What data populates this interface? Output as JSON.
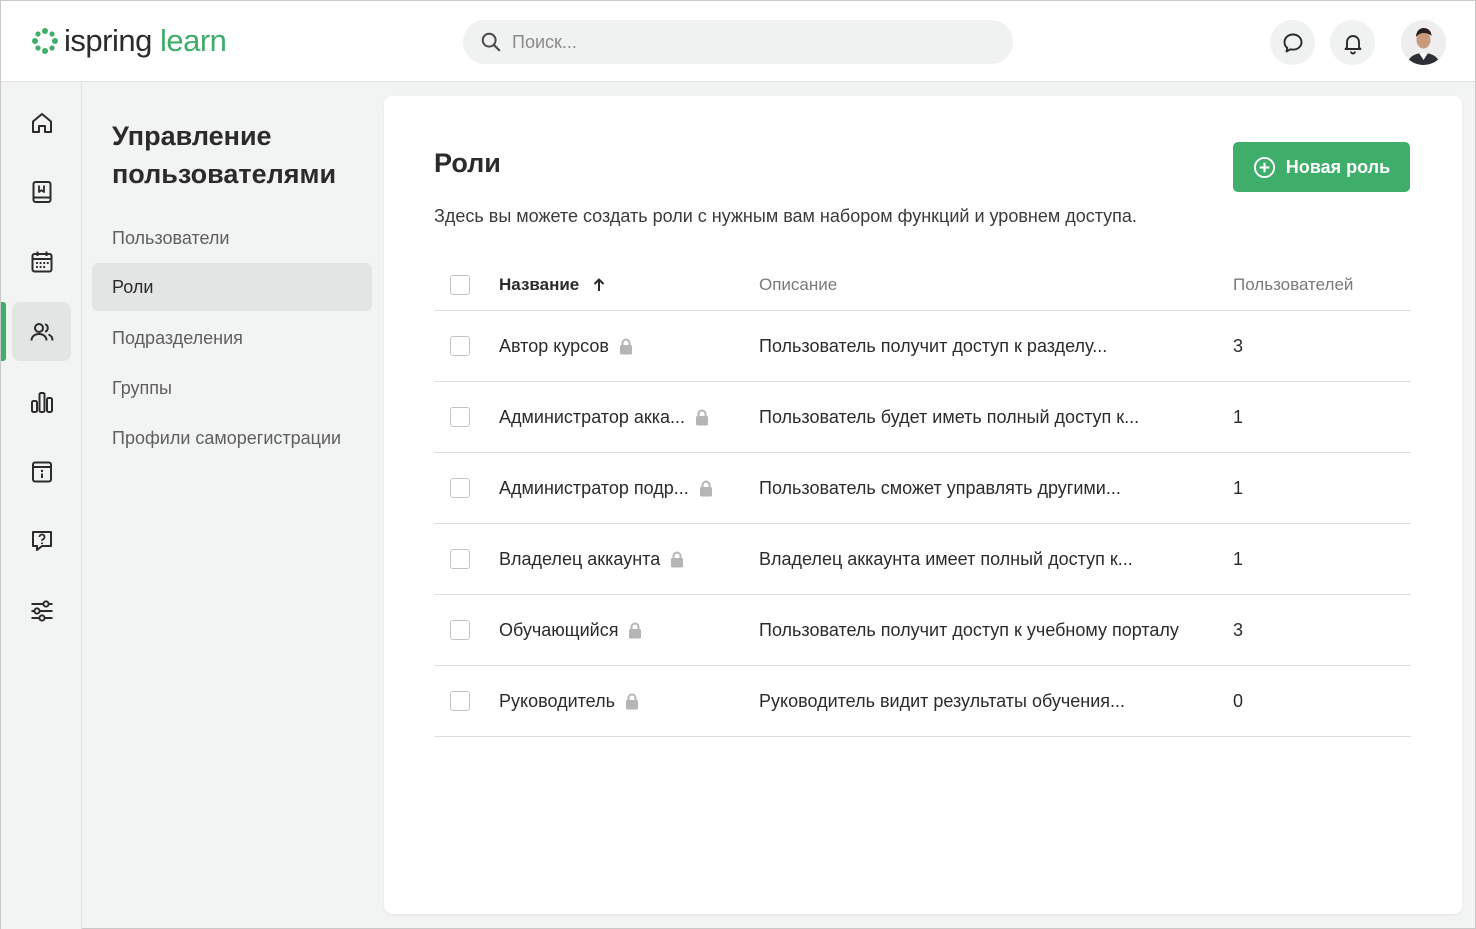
{
  "header": {
    "logo_part1": "ispring",
    "logo_part2": "learn",
    "search_placeholder": "Поиск..."
  },
  "rail": {
    "items": [
      "home-icon",
      "book-icon",
      "calendar-icon",
      "users-icon",
      "chart-icon",
      "info-card-icon",
      "help-chat-icon",
      "settings-sliders-icon"
    ],
    "active_index": 3
  },
  "subnav": {
    "title": "Управление пользователями",
    "items": [
      {
        "label": "Пользователи"
      },
      {
        "label": "Роли",
        "active": true
      },
      {
        "label": "Подразделения"
      },
      {
        "label": "Группы"
      },
      {
        "label": "Профили саморегистрации"
      }
    ]
  },
  "main": {
    "title": "Роли",
    "description": "Здесь вы можете создать роли с нужным вам набором функций и уровнем доступа.",
    "new_button_label": "Новая роль",
    "table": {
      "columns": [
        "Название",
        "Описание",
        "Пользователей"
      ],
      "rows": [
        {
          "name": "Автор курсов",
          "description": "Пользователь получит доступ к разделу...",
          "count": "3"
        },
        {
          "name": "Администратор акка...",
          "description": "Пользователь будет иметь полный доступ к...",
          "count": "1"
        },
        {
          "name": "Администратор подр...",
          "description": "Пользователь сможет управлять другими...",
          "count": "1"
        },
        {
          "name": "Владелец аккаунта",
          "description": "Владелец аккаунта имеет полный доступ к...",
          "count": "1"
        },
        {
          "name": "Обучающийся",
          "description": "Пользователь получит доступ к учебному порталу",
          "count": "3"
        },
        {
          "name": "Руководитель",
          "description": "Руководитель видит результаты обучения...",
          "count": "0"
        }
      ]
    }
  },
  "colors": {
    "accent": "#3fae6a",
    "background": "#f2f3f3",
    "panel": "#ffffff"
  }
}
